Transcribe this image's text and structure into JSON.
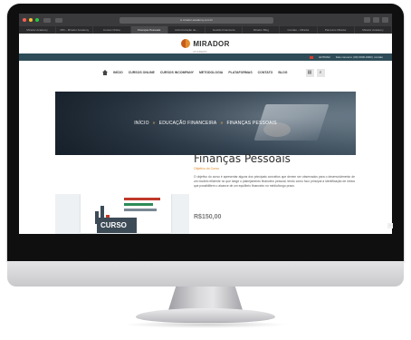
{
  "browser": {
    "url": "● mirador-academy.com.br",
    "tabs": [
      "Mirador Academy",
      "MM – Mirador Academy",
      "Cursos Online",
      "Finanças Pessoais",
      "Administração de...",
      "Gestão Financeira",
      "Mirador Blog",
      "Contato – Mirador",
      "Parceiros Mirador",
      "Mirador Academy"
    ],
    "active_tab_index": 3
  },
  "site": {
    "logo_text": "MIRADOR",
    "logo_sub": "ACADEMY",
    "topbar": {
      "login": "ENTRAR",
      "contact": "Fale conosco: (00) 0000-0000 | contato"
    },
    "nav": [
      "INÍCIO",
      "CURSOS ONLINE",
      "CURSOS INCOMPANY",
      "METODOLOGIA",
      "PLATAFORMAS",
      "CONTATO",
      "BLOG"
    ],
    "nav_icons": [
      "cart-icon",
      "search-icon"
    ]
  },
  "hero": {
    "breadcrumb": [
      "INÍCIO",
      "EDUCAÇÃO FINANCEIRA",
      "FINANÇAS PESSOAIS"
    ],
    "separator": "»"
  },
  "course": {
    "title": "Finanças Pessoais",
    "subtitle": "Objetivo do Curso",
    "description": "O objetivo do curso é apresentar alguns dos principais conceitos que devem ser observados para o desenvolvimento de um modelo eficiente no que tange o planejamento financeiro pessoal, tendo como foco principal a identificação de meios que possibilitem o alcance de um equilíbrio financeiro no médio/longo prazo.",
    "price": "R$150,00",
    "image_caption": "CURSO"
  },
  "colors": {
    "topbar": "#2e4c57",
    "accent": "#e08a2a",
    "hero_text": "#ffffff"
  }
}
